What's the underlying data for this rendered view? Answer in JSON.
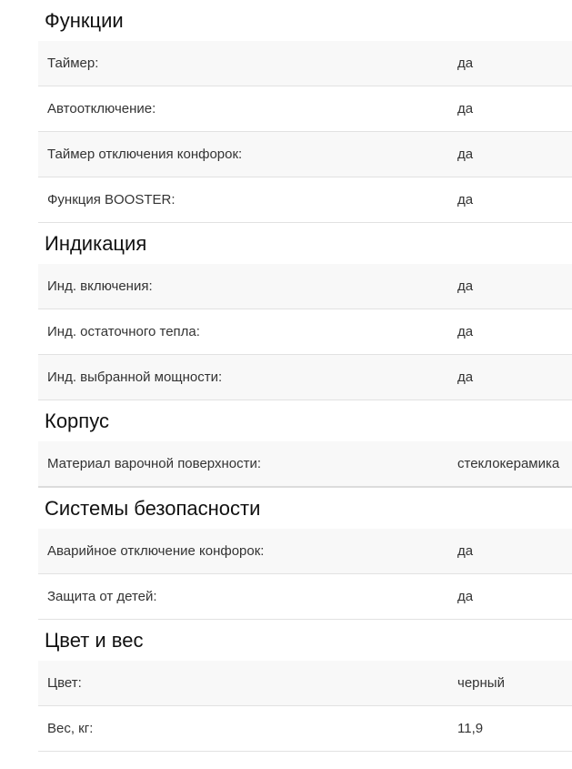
{
  "sections": [
    {
      "title": "Функции",
      "rows": [
        {
          "label": "Таймер:",
          "value": "да"
        },
        {
          "label": "Автоотключение:",
          "value": "да"
        },
        {
          "label": "Таймер отключения конфорок:",
          "value": "да"
        },
        {
          "label": "Функция BOOSTER:",
          "value": "да"
        }
      ]
    },
    {
      "title": "Индикация",
      "rows": [
        {
          "label": "Инд. включения:",
          "value": "да"
        },
        {
          "label": "Инд. остаточного тепла:",
          "value": "да"
        },
        {
          "label": "Инд. выбранной мощности:",
          "value": "да"
        }
      ]
    },
    {
      "title": "Корпус",
      "rows": [
        {
          "label": "Материал варочной поверхности:",
          "value": "стеклокерамика"
        }
      ]
    },
    {
      "title": "Системы безопасности",
      "rows": [
        {
          "label": "Аварийное отключение конфорок:",
          "value": "да"
        },
        {
          "label": "Защита от детей:",
          "value": "да"
        }
      ]
    },
    {
      "title": "Цвет и вес",
      "rows": [
        {
          "label": "Цвет:",
          "value": "черный"
        },
        {
          "label": "Вес, кг:",
          "value": "11,9"
        }
      ]
    }
  ]
}
